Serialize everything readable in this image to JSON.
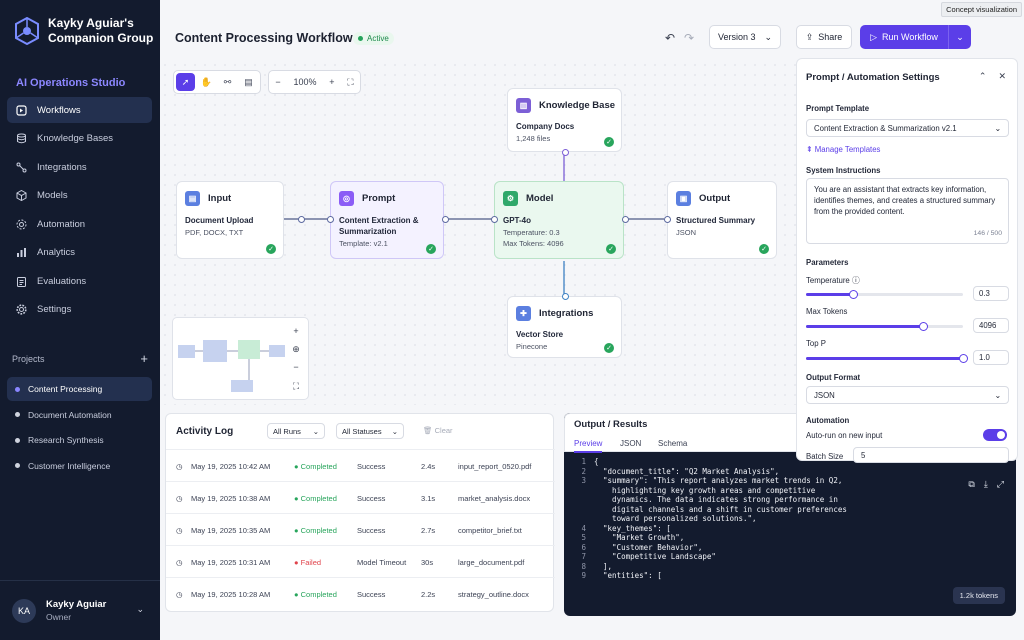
{
  "tooltip": "Concept visualization",
  "sidebar": {
    "brand_line1": "Kayky Aguiar's",
    "brand_line2": "Companion Group",
    "section": "AI Operations Studio",
    "items": [
      {
        "label": "Workflows",
        "icon": "workflow-icon"
      },
      {
        "label": "Knowledge Bases",
        "icon": "database-icon"
      },
      {
        "label": "Integrations",
        "icon": "integrations-icon"
      },
      {
        "label": "Models",
        "icon": "cube-icon"
      },
      {
        "label": "Automation",
        "icon": "automation-icon"
      },
      {
        "label": "Analytics",
        "icon": "bar-chart-icon"
      },
      {
        "label": "Evaluations",
        "icon": "clipboard-icon"
      },
      {
        "label": "Settings",
        "icon": "gear-icon"
      }
    ],
    "projects_label": "Projects",
    "projects": [
      "Content Processing",
      "Document Automation",
      "Research Synthesis",
      "Customer Intelligence"
    ],
    "user": {
      "initials": "KA",
      "name": "Kayky Aguiar",
      "role": "Owner"
    }
  },
  "header": {
    "title": "Content Processing Workflow",
    "status": "Active",
    "version": "Version 3",
    "share": "Share",
    "run": "Run Workflow"
  },
  "canvas": {
    "zoom": "100%",
    "nodes": {
      "input": {
        "title": "Input",
        "sub": "Document Upload",
        "meta": "PDF, DOCX, TXT"
      },
      "prompt": {
        "title": "Prompt",
        "sub1": "Content Extraction &",
        "sub2": "Summarization",
        "meta": "Template: v2.1"
      },
      "model": {
        "title": "Model",
        "sub": "GPT-4o",
        "meta1": "Temperature: 0.3",
        "meta2": "Max Tokens: 4096"
      },
      "output": {
        "title": "Output",
        "sub": "Structured Summary",
        "meta": "JSON"
      },
      "kb": {
        "title": "Knowledge Base",
        "sub": "Company Docs",
        "meta": "1,248 files"
      },
      "integ": {
        "title": "Integrations",
        "sub": "Vector Store",
        "meta": "Pinecone"
      }
    }
  },
  "activity": {
    "title": "Activity Log",
    "filter_runs": "All Runs",
    "filter_status": "All Statuses",
    "clear": "Clear",
    "rows": [
      {
        "time": "May 19, 2025 10:42 AM",
        "status": "Completed",
        "result": "Success",
        "dur": "2.4s",
        "file": "input_report_0520.pdf"
      },
      {
        "time": "May 19, 2025 10:38 AM",
        "status": "Completed",
        "result": "Success",
        "dur": "3.1s",
        "file": "market_analysis.docx"
      },
      {
        "time": "May 19, 2025 10:35 AM",
        "status": "Completed",
        "result": "Success",
        "dur": "2.7s",
        "file": "competitor_brief.txt"
      },
      {
        "time": "May 19, 2025 10:31 AM",
        "status": "Failed",
        "result": "Model Timeout",
        "dur": "30s",
        "file": "large_document.pdf"
      },
      {
        "time": "May 19, 2025 10:28 AM",
        "status": "Completed",
        "result": "Success",
        "dur": "2.2s",
        "file": "strategy_outline.docx"
      }
    ]
  },
  "results": {
    "title": "Output / Results",
    "tabs": [
      "Preview",
      "JSON",
      "Schema"
    ],
    "lines": [
      {
        "n": "1",
        "t": "{"
      },
      {
        "n": "2",
        "t": "  \"document_title\": \"Q2 Market Analysis\","
      },
      {
        "n": "3",
        "t": "  \"summary\": \"This report analyzes market trends in Q2,"
      },
      {
        "n": "",
        "t": "    highlighting key growth areas and competitive"
      },
      {
        "n": "",
        "t": "    dynamics. The data indicates strong performance in"
      },
      {
        "n": "",
        "t": "    digital channels and a shift in customer preferences"
      },
      {
        "n": "",
        "t": "    toward personalized solutions.\","
      },
      {
        "n": "4",
        "t": "  \"key_themes\": ["
      },
      {
        "n": "5",
        "t": "    \"Market Growth\","
      },
      {
        "n": "6",
        "t": "    \"Customer Behavior\","
      },
      {
        "n": "7",
        "t": "    \"Competitive Landscape\""
      },
      {
        "n": "8",
        "t": "  ],"
      },
      {
        "n": "9",
        "t": "  \"entities\": ["
      }
    ],
    "tokens": "1.2k tokens"
  },
  "settings": {
    "title": "Prompt / Automation Settings",
    "template_label": "Prompt Template",
    "template_value": "Content Extraction & Summarization v2.1",
    "manage": "Manage Templates",
    "sys_label": "System Instructions",
    "sys_text": "You are an assistant that extracts key information, identifies themes, and creates a structured summary from the provided content.",
    "sys_count": "146 / 500",
    "params_label": "Parameters",
    "temp_label": "Temperature",
    "temp_value": "0.3",
    "temp_fraction": 0.3,
    "maxtok_label": "Max Tokens",
    "maxtok_value": "4096",
    "maxtok_fraction": 0.75,
    "topp_label": "Top P",
    "topp_value": "1.0",
    "topp_fraction": 1.0,
    "format_label": "Output Format",
    "format_value": "JSON",
    "automation_label": "Automation",
    "autorun_label": "Auto-run on new input",
    "autorun_on": true,
    "batch_label": "Batch Size",
    "batch_value": "5"
  },
  "colors": {
    "accent": "#5b3ee8",
    "success": "#28a55c",
    "failed": "#e0434b",
    "sidebar": "#131b2e"
  }
}
